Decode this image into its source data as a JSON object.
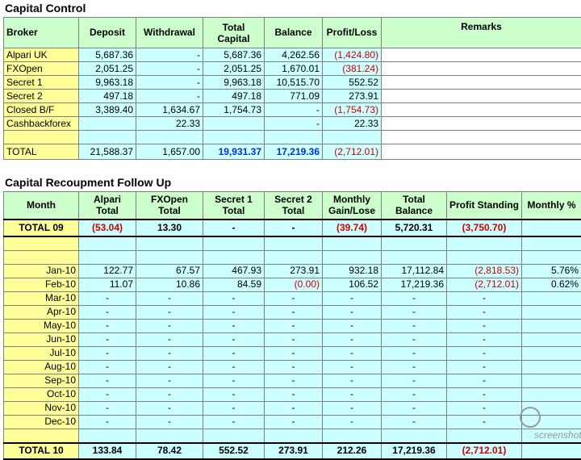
{
  "capital_control": {
    "title": "Capital Control",
    "headers": [
      "Broker",
      "Deposit",
      "Withdrawal",
      "Total Capital",
      "Balance",
      "Profit/Loss",
      "Remarks"
    ],
    "rows": [
      [
        "Alpari UK",
        "5,687.36",
        "-",
        "5,687.36",
        "4,262.56",
        "(1,424.80)",
        ""
      ],
      [
        "FXOpen",
        "2,051.25",
        "-",
        "2,051.25",
        "1,670.01",
        "(381.24)",
        ""
      ],
      [
        "Secret 1",
        "9,963.18",
        "-",
        "9,963.18",
        "10,515.70",
        "552.52",
        ""
      ],
      [
        "Secret 2",
        "497.18",
        "-",
        "497.18",
        "771.09",
        "273.91",
        ""
      ],
      [
        "Closed B/F",
        "3,389.40",
        "1,634.67",
        "1,754.73",
        "-",
        "(1,754.73)",
        ""
      ],
      [
        "Cashbackforex",
        "",
        "22.33",
        "",
        "-",
        "22.33",
        ""
      ],
      [
        "",
        "",
        "",
        "",
        "",
        "",
        ""
      ],
      [
        "TOTAL",
        "21,588.37",
        "1,657.00",
        "19,931.37",
        "17,219.36",
        "(2,712.01)",
        ""
      ]
    ]
  },
  "recoupment": {
    "title": "Capital Recoupment Follow Up",
    "headers": [
      "Month",
      "Alpari Total",
      "FXOpen Total",
      "Secret 1 Total",
      "Secret 2 Total",
      "Monthly Gain/Lose",
      "Total Balance",
      "Profit Standing",
      "Monthly %"
    ],
    "total09": [
      "TOTAL 09",
      "(53.04)",
      "13.30",
      "-",
      "-",
      "(39.74)",
      "5,720.31",
      "(3,750.70)",
      ""
    ],
    "rows": [
      [
        "",
        "",
        "",
        "",
        "",
        "",
        "",
        "",
        ""
      ],
      [
        "",
        "",
        "",
        "",
        "",
        "",
        "",
        "",
        ""
      ],
      [
        "Jan-10",
        "122.77",
        "67.57",
        "467.93",
        "273.91",
        "932.18",
        "17,112.84",
        "(2,818.53)",
        "5.76%"
      ],
      [
        "Feb-10",
        "11.07",
        "10.86",
        "84.59",
        "(0.00)",
        "106.52",
        "17,219.36",
        "(2,712.01)",
        "0.62%"
      ],
      [
        "Mar-10",
        "-",
        "-",
        "-",
        "-",
        "-",
        "-",
        "-",
        ""
      ],
      [
        "Apr-10",
        "-",
        "-",
        "-",
        "-",
        "-",
        "-",
        "-",
        ""
      ],
      [
        "May-10",
        "-",
        "-",
        "-",
        "-",
        "-",
        "-",
        "-",
        ""
      ],
      [
        "Jun-10",
        "-",
        "-",
        "-",
        "-",
        "-",
        "-",
        "-",
        ""
      ],
      [
        "Jul-10",
        "-",
        "-",
        "-",
        "-",
        "-",
        "-",
        "-",
        ""
      ],
      [
        "Aug-10",
        "-",
        "-",
        "-",
        "-",
        "-",
        "-",
        "-",
        ""
      ],
      [
        "Sep-10",
        "-",
        "-",
        "-",
        "-",
        "-",
        "-",
        "-",
        ""
      ],
      [
        "Oct-10",
        "-",
        "-",
        "-",
        "-",
        "-",
        "-",
        "-",
        ""
      ],
      [
        "Nov-10",
        "-",
        "-",
        "-",
        "-",
        "-",
        "-",
        "-",
        ""
      ],
      [
        "Dec-10",
        "-",
        "-",
        "-",
        "-",
        "-",
        "-",
        "-",
        ""
      ],
      [
        "",
        "",
        "",
        "",
        "",
        "",
        "",
        "",
        ""
      ]
    ],
    "total10": [
      "TOTAL 10",
      "133.84",
      "78.42",
      "552.52",
      "273.91",
      "212.26",
      "17,219.36",
      "(2,712.01)",
      ""
    ]
  },
  "watermark": {
    "text": "screenshot",
    "icon": "camera-lens-icon"
  },
  "colors": {
    "header_bg": "#ccffcc",
    "label_bg": "#ffff99",
    "value_bg": "#ccffff",
    "negative": "#cc0000",
    "highlight": "#0033cc"
  }
}
